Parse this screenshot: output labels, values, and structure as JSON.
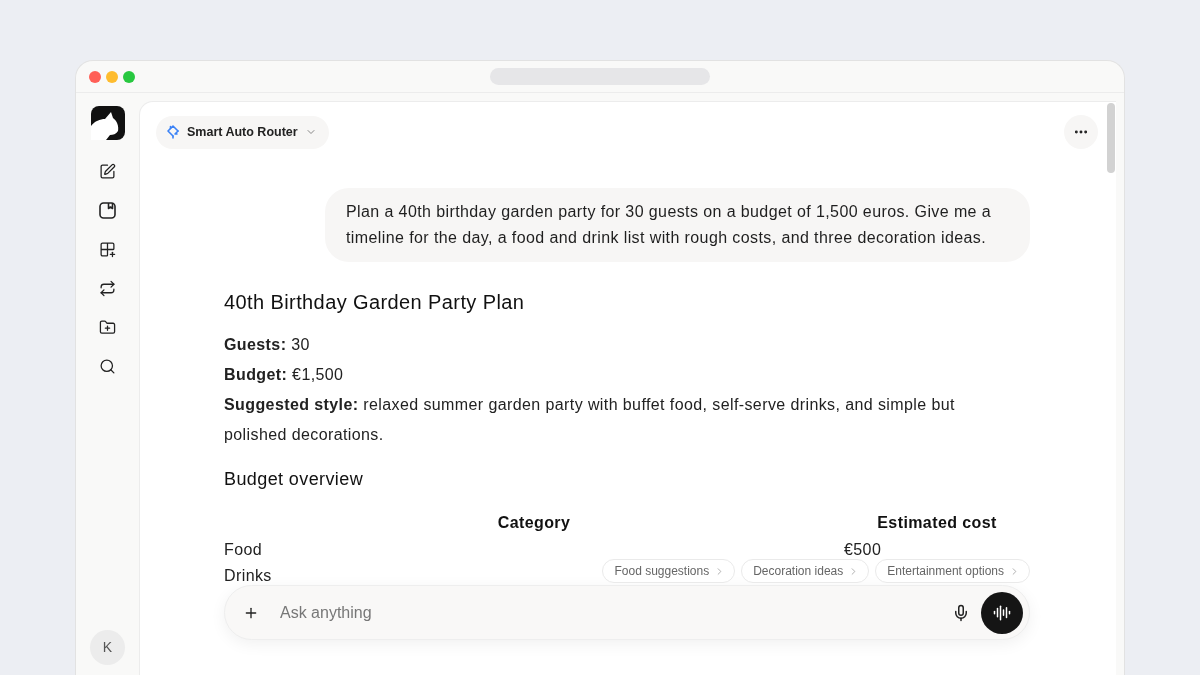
{
  "sidebar": {
    "avatar": {
      "initial": "K"
    }
  },
  "toolbar": {
    "model_selector": {
      "label": "Smart Auto Router"
    }
  },
  "conversation": {
    "user_message": "Plan a 40th birthday garden party for 30 guests on a budget of 1,500 euros. Give me a timeline for the day, a food and drink list with rough costs, and three decoration ideas.",
    "response": {
      "title": "40th Birthday Garden Party Plan",
      "facts": [
        "**Guests:** 30",
        "**Budget:** €1,500",
        "**Suggested style:** relaxed summer garden party with buffet food, self-serve drinks, and simple but polished decorations."
      ],
      "section_heading": "Budget overview",
      "table": {
        "columns": [
          "Category",
          "Estimated cost"
        ],
        "rows": [
          [
            "Food",
            "€500"
          ],
          [
            "Drinks"
          ]
        ]
      }
    }
  },
  "suggestions": [
    {
      "label": "Food suggestions"
    },
    {
      "label": "Decoration ideas"
    },
    {
      "label": "Entertainment options"
    }
  ],
  "composer": {
    "placeholder": "Ask anything"
  }
}
